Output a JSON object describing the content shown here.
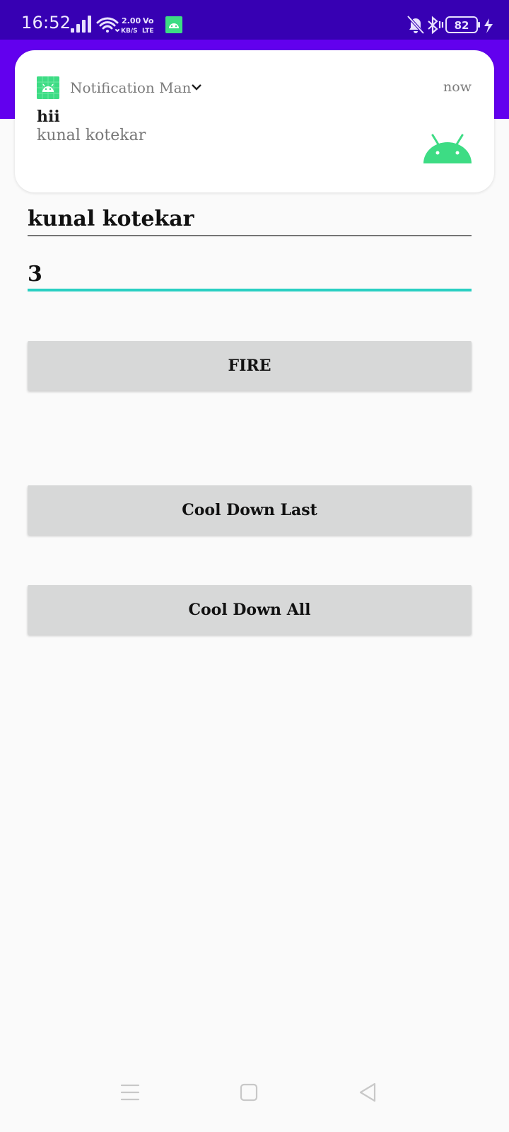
{
  "status_bar": {
    "time": "16:52",
    "network_speed_value": "2.00",
    "network_speed_unit": "KB/S",
    "volte_top": "Vo",
    "volte_bottom": "LTE",
    "battery_level": "82",
    "icons": [
      "signal-icon",
      "wifi-icon",
      "android-app-icon",
      "mute-icon",
      "bluetooth-icon",
      "battery-icon",
      "charging-icon"
    ]
  },
  "notification": {
    "app_name": "Notification Man",
    "time": "now",
    "title": "hii",
    "text": "kunal kotekar",
    "icon_color": "#3ddc84"
  },
  "form": {
    "name_value": "kunal kotekar",
    "count_value": "3"
  },
  "buttons": {
    "fire": "FIRE",
    "cool_down_last": "Cool Down Last",
    "cool_down_all": "Cool Down All"
  },
  "navigation": {
    "items": [
      "menu-icon",
      "home-icon",
      "back-icon"
    ]
  },
  "colors": {
    "status_bar": "#3700b3",
    "app_bar": "#6200ee",
    "accent": "#29cfc2",
    "button": "#d7d8d8"
  }
}
